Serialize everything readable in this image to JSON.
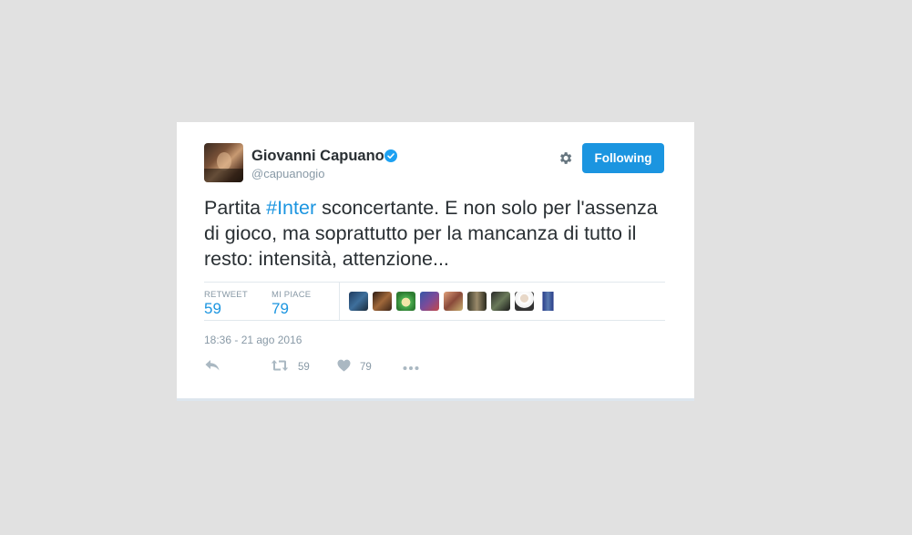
{
  "tweet": {
    "author_name": "Giovanni Capuano",
    "author_handle": "@capuanogio",
    "follow_label": "Following",
    "text_before": "Partita ",
    "hashtag": "#Inter",
    "text_after": " sconcertante. E non solo per l'assenza di gioco, ma soprattutto per la mancanza di tutto il resto: intensità, attenzione...",
    "timestamp": "18:36 - 21 ago 2016"
  },
  "stats": {
    "retweet_label": "RETWEET",
    "retweet_count": "59",
    "likes_label": "MI PIACE",
    "likes_count": "79"
  },
  "actions": {
    "retweet_count": "59",
    "like_count": "79"
  },
  "icons": {
    "verified": "verified-badge-icon",
    "settings": "gear-icon",
    "reply": "reply-icon",
    "retweet": "retweet-icon",
    "like": "heart-icon",
    "more": "more-dots-icon"
  },
  "colors": {
    "accent": "#1b95e0",
    "text": "#292f33",
    "muted": "#8899a6",
    "background": "#e1e1e1"
  }
}
